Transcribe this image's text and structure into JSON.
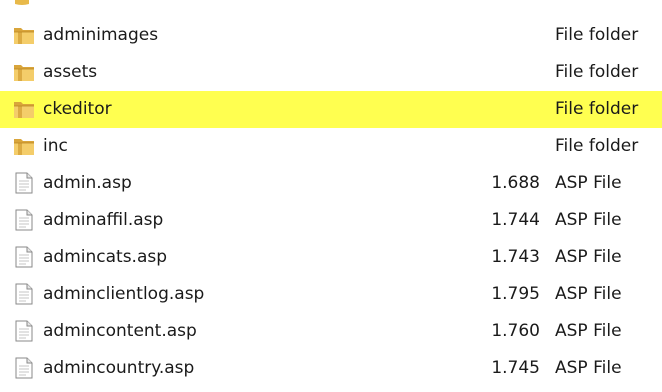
{
  "files": [
    {
      "name": "adminimages",
      "size": "",
      "type": "File folder",
      "icon": "folder-icon",
      "selected": false
    },
    {
      "name": "assets",
      "size": "",
      "type": "File folder",
      "icon": "folder-icon",
      "selected": false
    },
    {
      "name": "ckeditor",
      "size": "",
      "type": "File folder",
      "icon": "folder-icon",
      "selected": true
    },
    {
      "name": "inc",
      "size": "",
      "type": "File folder",
      "icon": "folder-icon",
      "selected": false
    },
    {
      "name": "admin.asp",
      "size": "1.688",
      "type": "ASP File",
      "icon": "document-icon",
      "selected": false
    },
    {
      "name": "adminaffil.asp",
      "size": "1.744",
      "type": "ASP File",
      "icon": "document-icon",
      "selected": false
    },
    {
      "name": "admincats.asp",
      "size": "1.743",
      "type": "ASP File",
      "icon": "document-icon",
      "selected": false
    },
    {
      "name": "adminclientlog.asp",
      "size": "1.795",
      "type": "ASP File",
      "icon": "document-icon",
      "selected": false
    },
    {
      "name": "admincontent.asp",
      "size": "1.760",
      "type": "ASP File",
      "icon": "document-icon",
      "selected": false
    },
    {
      "name": "admincountry.asp",
      "size": "1.745",
      "type": "ASP File",
      "icon": "document-icon",
      "selected": false
    }
  ],
  "colors": {
    "selection_highlight": "#ffff50",
    "folder": "#e8b94a",
    "text": "#1a1a1a"
  }
}
